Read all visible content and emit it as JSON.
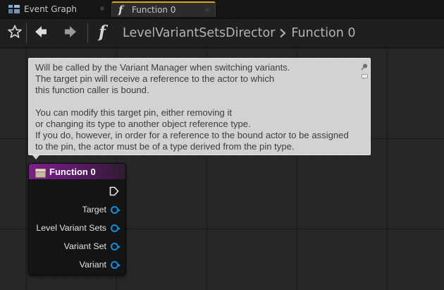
{
  "tabs": [
    {
      "label": "Event Graph",
      "icon": "event-graph-icon",
      "active": false
    },
    {
      "label": "Function  0",
      "icon": "function-icon",
      "active": true
    }
  ],
  "toolbar": {
    "icons": [
      "star-icon",
      "back-arrow-icon",
      "forward-arrow-icon",
      "function-icon"
    ],
    "breadcrumb": {
      "parent": "LevelVariantSetsDirector",
      "current": "Function  0"
    }
  },
  "comment": {
    "lines": [
      "Will be called by the Variant Manager when switching variants.",
      "The target pin will receive a reference to the actor to which",
      "this function caller is bound.",
      "",
      "You can modify this target pin, either removing it",
      "or changing its type to another object reference type.",
      "If you do, however, in order for a reference to the bound actor to be assigned",
      "to the pin, the actor must be of a type derived from the pin type."
    ]
  },
  "node": {
    "title": "Function 0",
    "pins": [
      "Target",
      "Level Variant Sets",
      "Variant Set",
      "Variant"
    ]
  },
  "colors": {
    "accent_tab": "#d9a514",
    "node_header": "#7d1f8c",
    "object_pin": "#0f8fd6",
    "comment_bg": "#d2d2d2",
    "graph_bg": "#262626"
  }
}
